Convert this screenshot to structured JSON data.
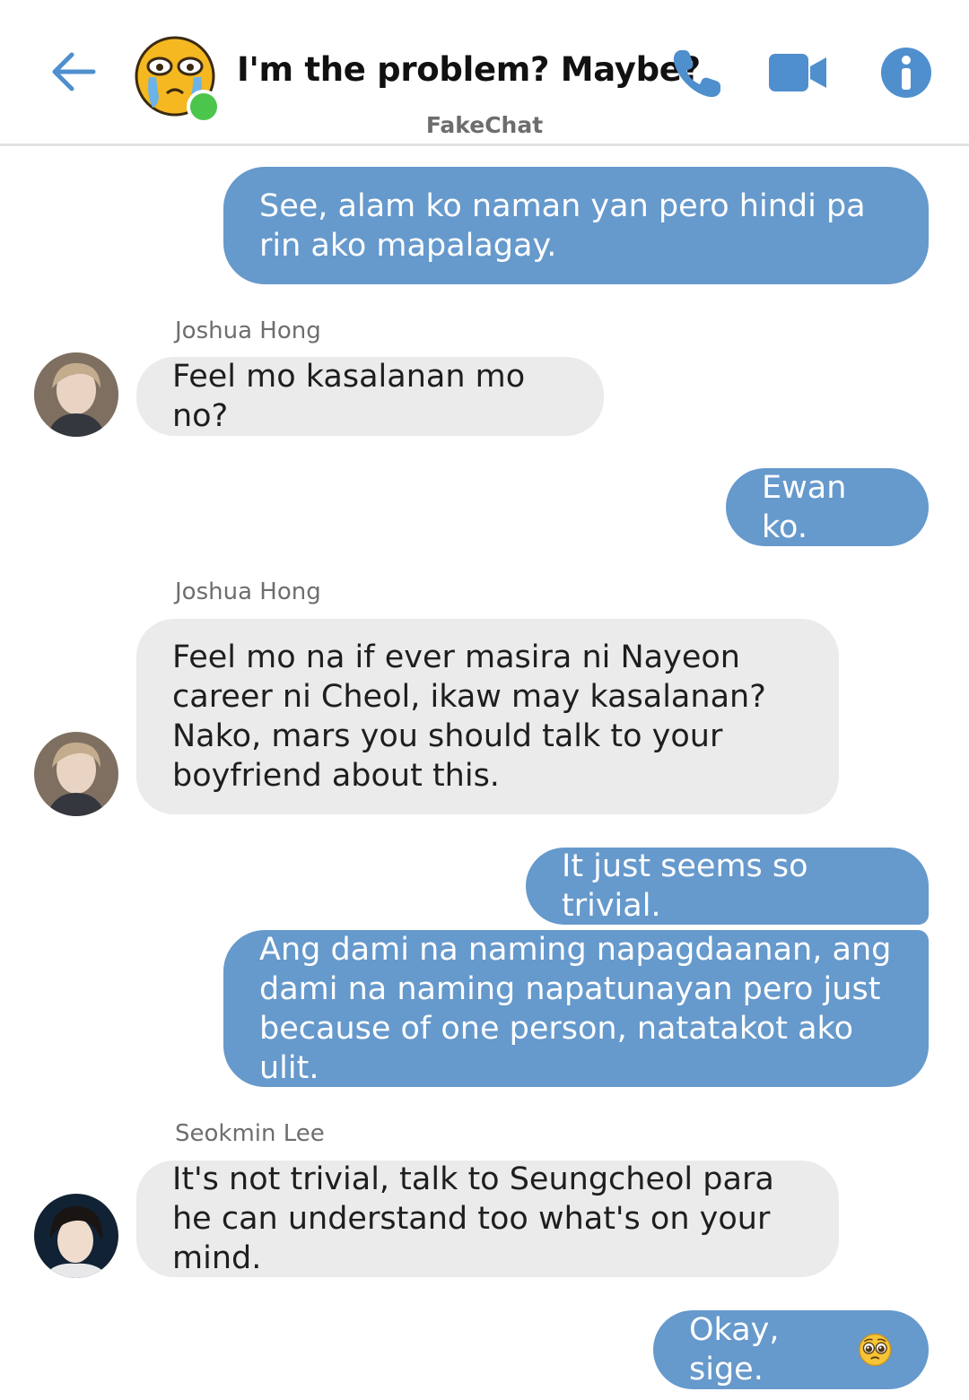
{
  "header": {
    "title": "I'm the problem? Maybe?",
    "app_name": "FakeChat",
    "accent_color": "#4f8fce",
    "online_color": "#4cc54c",
    "icons": [
      "back-arrow-icon",
      "crying-emoji-avatar",
      "phone-icon",
      "video-camera-icon",
      "info-icon"
    ]
  },
  "colors": {
    "outgoing_bubble": "#6699cc",
    "incoming_bubble": "#ebebeb"
  },
  "messages": [
    {
      "type": "out",
      "text": "See, alam ko naman yan pero hindi pa rin ako mapalagay."
    },
    {
      "type": "in",
      "sender": "Joshua Hong",
      "text": "Feel mo kasalanan mo no?"
    },
    {
      "type": "out",
      "text": "Ewan ko."
    },
    {
      "type": "in",
      "sender": "Joshua Hong",
      "text": "Feel mo na if ever masira ni Nayeon career ni Cheol, ikaw may kasalanan? Nako, mars you should talk to your boyfriend about this."
    },
    {
      "type": "out",
      "text": "It just seems so trivial."
    },
    {
      "type": "out",
      "text": "Ang dami na naming napagdaanan, ang dami na naming napatunayan pero just because of one person, natatakot ako ulit."
    },
    {
      "type": "in",
      "sender": "Seokmin Lee",
      "text": "It's not trivial, talk to Seungcheol para he can understand too what's on your mind."
    },
    {
      "type": "out",
      "text": "Okay, sige.",
      "emoji": "pleading-face-emoji"
    }
  ]
}
